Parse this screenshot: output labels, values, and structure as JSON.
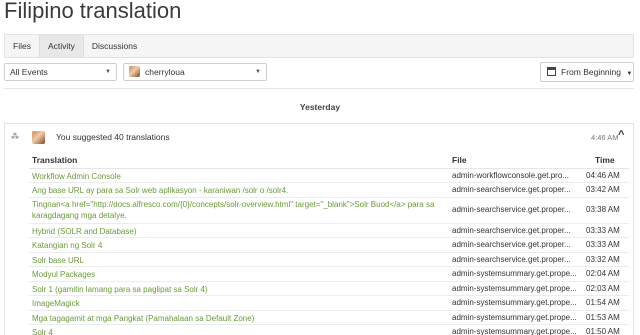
{
  "page": {
    "title": "Filipino translation"
  },
  "tabs": [
    {
      "label": "Files",
      "active": false
    },
    {
      "label": "Activity",
      "active": true
    },
    {
      "label": "Discussions",
      "active": false
    }
  ],
  "filters": {
    "events_value": "All Events",
    "user_value": "cherryloua",
    "order_value": "From Beginning"
  },
  "feed": {
    "day_label": "Yesterday",
    "summary": "You suggested 40 translations",
    "time": "4:46 AM",
    "columns": {
      "translation": "Translation",
      "file": "File",
      "time": "Time"
    },
    "rows": [
      {
        "translation": "Workflow Admin Console",
        "file": "admin-workflowconsole.get.pro...",
        "time": "04:46 AM"
      },
      {
        "translation": "Ang base URL ay para sa Solr web aplikasyon - karaniwan /solr o /solr4.",
        "file": "admin-searchservice.get.proper...",
        "time": "03:42 AM"
      },
      {
        "translation": "Tingnan<a href=\"http://docs.alfresco.com/{0}/concepts/solr-overview.html\" target=\"_blank\">Solr Buod</a> para sa karagdagang mga detalye.",
        "file": "admin-searchservice.get.proper...",
        "time": "03:38 AM"
      },
      {
        "translation": "Hybrid (SOLR and Database)",
        "file": "admin-searchservice.get.proper...",
        "time": "03:33 AM"
      },
      {
        "translation": "Katangian ng Solr 4",
        "file": "admin-searchservice.get.proper...",
        "time": "03:33 AM"
      },
      {
        "translation": "Solr base URL",
        "file": "admin-searchservice.get.proper...",
        "time": "03:32 AM"
      },
      {
        "translation": "Modyul Packages",
        "file": "admin-systemsummary.get.prope...",
        "time": "02:04 AM"
      },
      {
        "translation": "Solr 1 (gamitin lamang para sa paglipat sa Solr 4)",
        "file": "admin-systemsummary.get.prope...",
        "time": "02:03 AM"
      },
      {
        "translation": "ImageMagick",
        "file": "admin-systemsummary.get.prope...",
        "time": "01:54 AM"
      },
      {
        "translation": "Mga tagagamit at mga Pangkat (Pamahalaan sa Default Zone)",
        "file": "admin-systemsummary.get.prope...",
        "time": "01:53 AM"
      },
      {
        "translation": "Solr 4",
        "file": "admin-systemsummary.get.prope...",
        "time": "01:50 AM"
      }
    ]
  }
}
